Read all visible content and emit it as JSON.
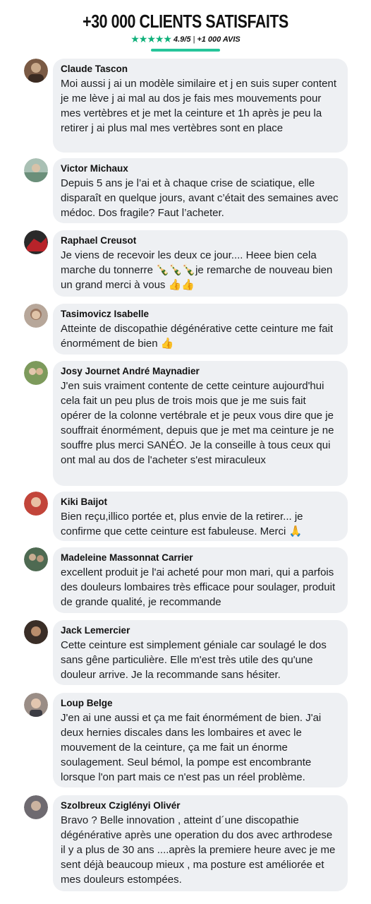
{
  "header": {
    "title": "+30 000 CLIENTS SATISFAITS",
    "stars": "★★★★★",
    "score": "4.9/5",
    "separator": "|",
    "count": "+1 000 AVIS"
  },
  "reviews": [
    {
      "name": "Claude Tascon",
      "avatar": "avatar-claude",
      "avatar_color": "#7a5a44",
      "text": "Moi aussi j ai un modèle similaire et j en suis super content je me lève j ai mal au dos je fais mes mouvements pour mes vertèbres et je met la ceinture et 1h après je peu la retirer j ai plus mal mes vertèbres sont en place"
    },
    {
      "name": "Victor Michaux",
      "avatar": "avatar-victor",
      "avatar_color": "#6b8f7a",
      "text": "Depuis 5 ans je l’ai et à chaque crise de sciatique, elle disparaît en quelque jours, avant c’était des semaines avec médoc. Dos fragile? Faut l’acheter."
    },
    {
      "name": "Raphael Creusot",
      "avatar": "avatar-raphael",
      "avatar_color": "#b8232a",
      "text": "Je viens de recevoir les deux ce jour.... Heee bien cela marche du tonnerre 🍾🍾🍾je remarche de nouveau bien un grand merci à vous 👍👍"
    },
    {
      "name": "Tasimovicz Isabelle",
      "avatar": "avatar-isabelle",
      "avatar_color": "#9a7660",
      "text": "Atteinte de discopathie dégénérative cette ceinture me fait énormément de bien 👍"
    },
    {
      "name": "Josy Journet André Maynadier",
      "avatar": "avatar-josy",
      "avatar_color": "#7d9a5c",
      "text": "J'en suis vraiment contente de cette ceinture aujourd'hui cela fait un peu plus de trois mois que je me suis fait opérer de la colonne vertébrale et je peux vous dire que je souffrait énormément, depuis que je met ma ceinture je ne souffre plus merci SANÉO. Je la conseille à tous ceux qui ont mal au dos de l'acheter s'est miraculeux"
    },
    {
      "name": "Kiki Baijot",
      "avatar": "avatar-kiki",
      "avatar_color": "#c2453a",
      "text": "Bien reçu,illico portée et, plus envie de la retirer... je confirme que cette ceinture est fabuleuse. Merci 🙏"
    },
    {
      "name": "Madeleine Massonnat Carrier",
      "avatar": "avatar-madeleine",
      "avatar_color": "#4e6a52",
      "text": "excellent produit je l'ai acheté pour mon mari, qui a parfois des douleurs lombaires très efficace pour soulager, produit de grande qualité, je recommande"
    },
    {
      "name": "Jack Lemercier",
      "avatar": "avatar-jack",
      "avatar_color": "#5a4336",
      "text": "Cette ceinture est simplement géniale car soulagé le dos sans gêne particulière. Elle m'est très utile des qu'une douleur arrive. Je la recommande sans hésiter."
    },
    {
      "name": "Loup Belge",
      "avatar": "avatar-loup",
      "avatar_color": "#8b7b72",
      "text": "J'en ai une aussi et ça me fait énormément de bien. J'ai deux hernies discales dans les lombaires et avec le mouvement de la ceinture, ça me fait un énorme soulagement. Seul bémol, la pompe est encombrante lorsque l'on part mais ce n'est pas un réel problème."
    },
    {
      "name": "Szolbreux Cziglényi Olivér",
      "avatar": "avatar-olivier",
      "avatar_color": "#6e6a70",
      "text": "Bravo ? Belle innovation , atteint d´une discopathie dégénérative après une operation du dos avec arthrodese il y a plus de 30 ans ....après la premiere heure avec je me sent déjà beaucoup mieux , ma posture est améliorée et mes douleurs estompées."
    }
  ]
}
